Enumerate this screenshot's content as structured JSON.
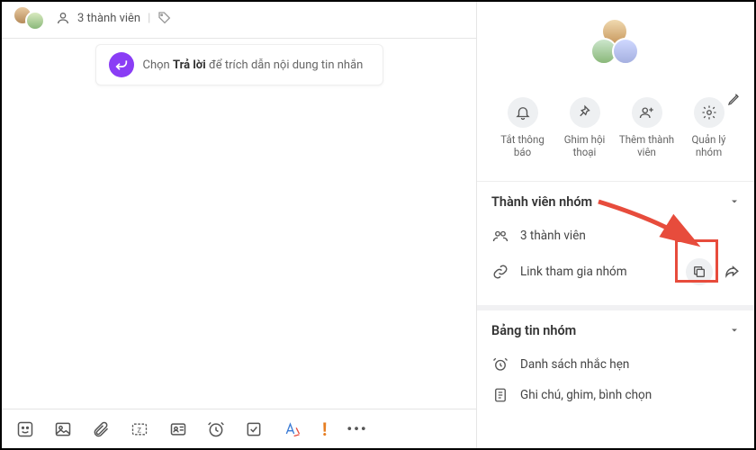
{
  "chat": {
    "member_count_label": "3 thành viên",
    "reply_hint_prefix": "Chọn",
    "reply_hint_bold": "Trả lời",
    "reply_hint_suffix": "để trích dẫn nội dung tin nhắn"
  },
  "info": {
    "actions": {
      "mute": "Tắt thông báo",
      "pin": "Ghim hội thoại",
      "add_member": "Thêm thành viên",
      "manage": "Quản lý nhóm"
    },
    "members_section": {
      "title": "Thành viên nhóm",
      "count_label": "3 thành viên",
      "link_label": "Link tham gia nhóm"
    },
    "board_section": {
      "title": "Bảng tin nhóm",
      "reminders": "Danh sách nhắc hẹn",
      "notes": "Ghi chú, ghim, bình chọn"
    }
  }
}
